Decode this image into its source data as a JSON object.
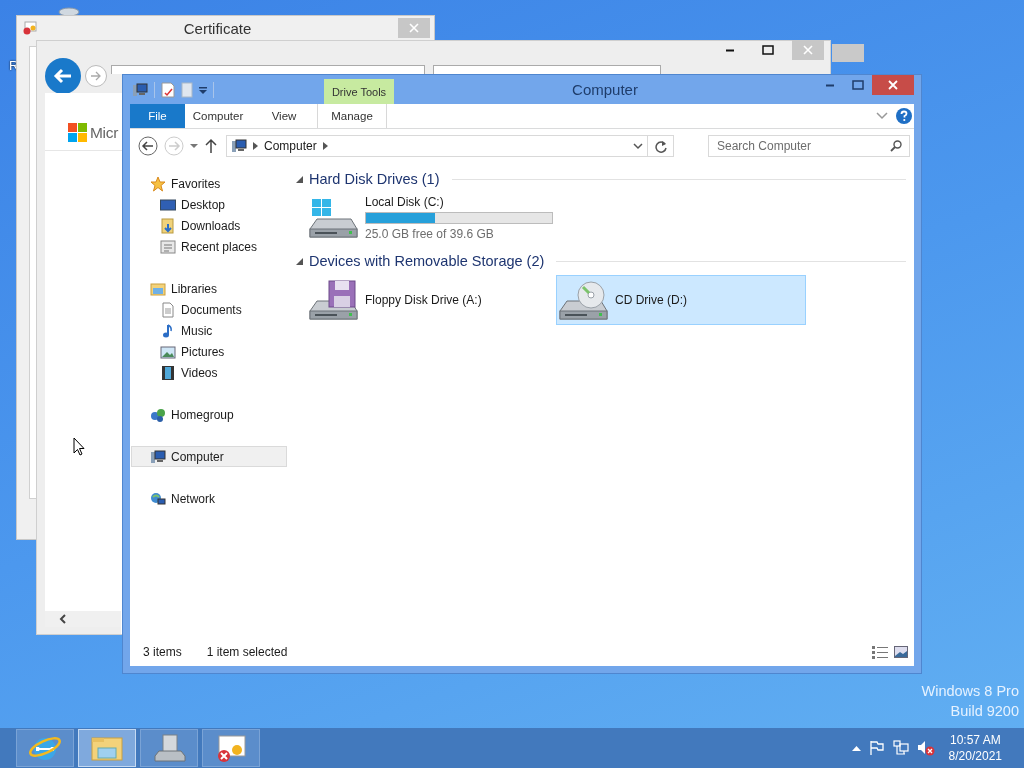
{
  "desktop": {
    "icon_label": "R",
    "edition": "Windows 8 Pro",
    "build": "Build 9200"
  },
  "certificate_window": {
    "title": "Certificate"
  },
  "browser_window": {
    "logo_text": "Micr"
  },
  "explorer": {
    "title": "Computer",
    "ribbon_group": "Drive Tools",
    "ribbon_tabs": [
      {
        "label": "File",
        "kind": "file"
      },
      {
        "label": "Computer",
        "kind": "tab"
      },
      {
        "label": "View",
        "kind": "tab"
      },
      {
        "label": "Manage",
        "kind": "contextual"
      }
    ],
    "address_path": [
      "Computer"
    ],
    "search": {
      "placeholder": "Search Computer"
    },
    "nav_pane": [
      {
        "label": "Favorites",
        "selected": false,
        "children": [
          {
            "label": "Desktop",
            "selected": false
          },
          {
            "label": "Downloads",
            "selected": false
          },
          {
            "label": "Recent places",
            "selected": false
          }
        ]
      },
      {
        "label": "Libraries",
        "selected": false,
        "children": [
          {
            "label": "Documents",
            "selected": false
          },
          {
            "label": "Music",
            "selected": false
          },
          {
            "label": "Pictures",
            "selected": false
          },
          {
            "label": "Videos",
            "selected": false
          }
        ]
      },
      {
        "label": "Homegroup",
        "selected": false
      },
      {
        "label": "Computer",
        "selected": true
      },
      {
        "label": "Network",
        "selected": false
      }
    ],
    "groups": [
      {
        "title": "Hard Disk Drives (1)",
        "expanded": true,
        "items": [
          {
            "name": "Local Disk (C:)",
            "kind": "disk",
            "level": 0.37,
            "reading": "25.0 GB free of 39.6 GB",
            "selected": false
          }
        ]
      },
      {
        "title": "Devices with Removable Storage (2)",
        "expanded": true,
        "items": [
          {
            "name": "Floppy Disk Drive (A:)",
            "kind": "floppy",
            "selected": false
          },
          {
            "name": "CD Drive (D:)",
            "kind": "cd",
            "selected": true
          }
        ]
      }
    ],
    "status_bar": {
      "item_count": "3 items",
      "selection": "1 item selected"
    }
  },
  "taskbar": {
    "buttons": [
      {
        "selected": false
      },
      {
        "selected": true
      },
      {
        "selected": false
      },
      {
        "selected": false
      }
    ],
    "time": "10:57 AM",
    "date": "8/20/2021"
  }
}
